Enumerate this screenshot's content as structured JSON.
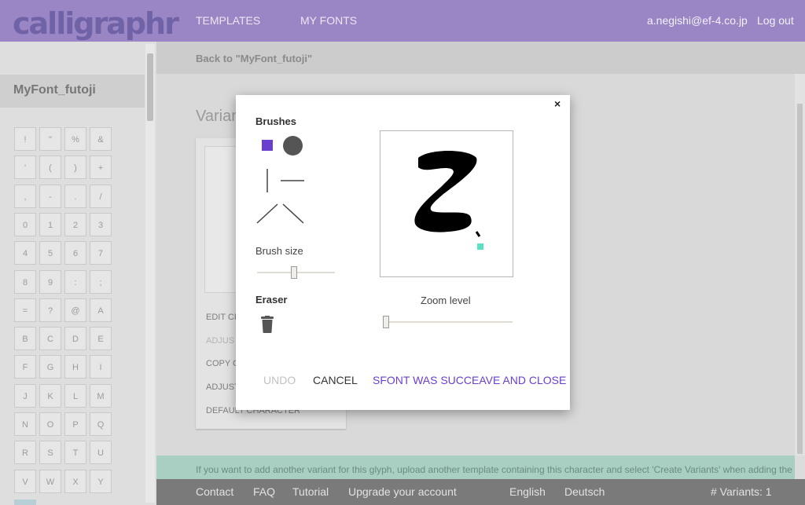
{
  "header": {
    "logo": "calligraphr",
    "nav": [
      "TEMPLATES",
      "MY FONTS"
    ],
    "user_email": "a.negishi@ef-4.co.jp",
    "logout": "Log out"
  },
  "subbar": {
    "back_link": "Back to \"MyFont_futoji\""
  },
  "sidebar": {
    "font_name": "MyFont_futoji",
    "glyphs": [
      "!",
      "\"",
      "%",
      "&",
      "'",
      "(",
      ")",
      "+",
      ",",
      "-",
      ".",
      "/",
      "0",
      "1",
      "2",
      "3",
      "4",
      "5",
      "6",
      "7",
      "8",
      "9",
      ":",
      ";",
      "=",
      "?",
      "@",
      "A",
      "B",
      "C",
      "D",
      "E",
      "F",
      "G",
      "H",
      "I",
      "J",
      "K",
      "L",
      "M",
      "N",
      "O",
      "P",
      "Q",
      "R",
      "S",
      "T",
      "U",
      "V",
      "W",
      "X",
      "Y"
    ]
  },
  "main": {
    "title": "Varian",
    "card_items": [
      "EDIT CH",
      "ADJUS",
      "COPY C",
      "ADJUST",
      "DEFAULT CHARACTER"
    ],
    "info_text": "If you want to add another variant for this glyph, upload another template containing this character and select 'Create Variants' when adding the"
  },
  "footer": {
    "links": [
      "Contact",
      "FAQ",
      "Tutorial",
      "Upgrade your account"
    ],
    "languages": [
      "English",
      "Deutsch"
    ],
    "variants": "# Variants: 1"
  },
  "modal": {
    "brushes_label": "Brushes",
    "brush_size_label": "Brush size",
    "brush_size_level": 0.47,
    "eraser_label": "Eraser",
    "zoom_label": "Zoom level",
    "zoom_level": 0.0,
    "undo": "UNDO",
    "cancel": "CANCEL",
    "save": "SFONT WAS SUCCEAVE AND CLOSE",
    "close": "×"
  },
  "colors": {
    "accent": "#6a3fcf",
    "header": "#9a86c4",
    "cursor": "#5be0c3"
  }
}
